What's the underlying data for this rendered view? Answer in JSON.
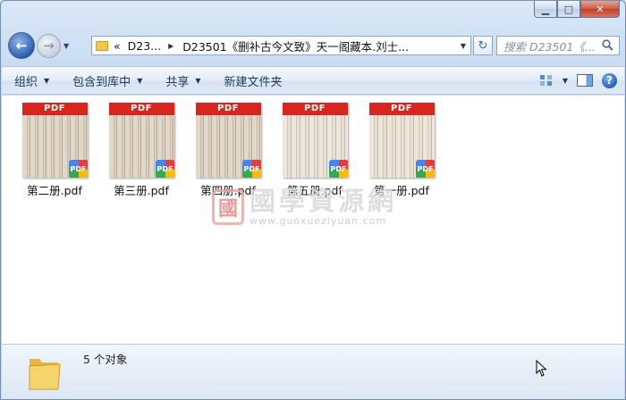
{
  "window": {
    "min_glyph": "▁",
    "max_glyph": "□",
    "close_glyph": "✕"
  },
  "nav": {
    "back_glyph": "←",
    "forward_glyph": "→",
    "dropdown_glyph": "▼"
  },
  "address": {
    "prefix": "«",
    "crumbs": [
      "D23...",
      "D23501《删补古今文致》天一阁藏本.刘士..."
    ],
    "separator": "▶",
    "dropdown_glyph": "▼"
  },
  "refresh_glyph": "↻",
  "search": {
    "placeholder": "搜索 D23501《..."
  },
  "toolbar": {
    "organize": "组织",
    "include_in_library": "包含到库中",
    "share": "共享",
    "new_folder": "新建文件夹",
    "help": "?"
  },
  "files": [
    {
      "name": "第二册.pdf",
      "band": "PDF",
      "badge": "PDF"
    },
    {
      "name": "第三册.pdf",
      "band": "PDF",
      "badge": "PDF"
    },
    {
      "name": "第四册.pdf",
      "band": "PDF",
      "badge": "PDF"
    },
    {
      "name": "第五册.pdf",
      "band": "PDF",
      "badge": "PDF"
    },
    {
      "name": "第一册.pdf",
      "band": "PDF",
      "badge": "PDF"
    }
  ],
  "watermark": {
    "seal": "國",
    "title": "國學資源網",
    "url": "www.guoxueziyuan.com"
  },
  "status": {
    "count_text": "5 个对象"
  }
}
